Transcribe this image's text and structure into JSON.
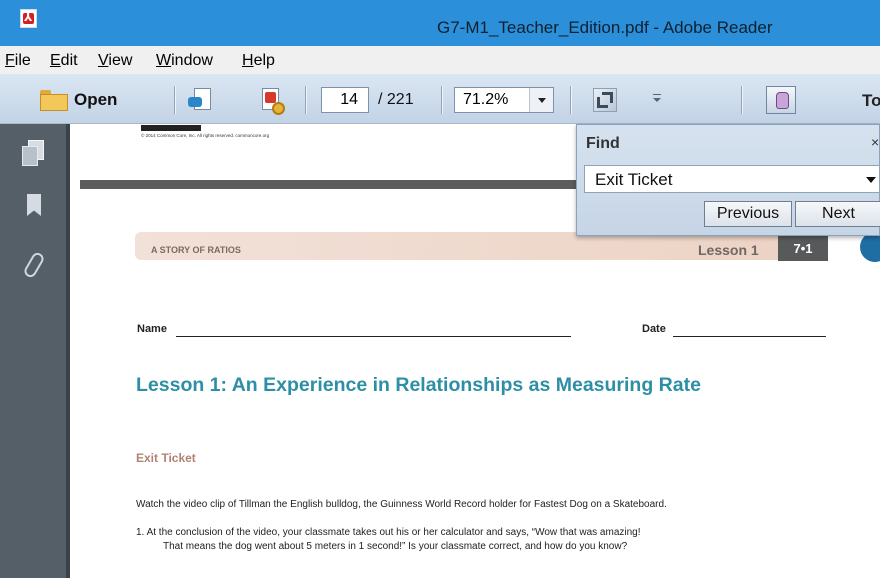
{
  "window": {
    "title": "G7-M1_Teacher_Edition.pdf - Adobe Reader"
  },
  "menu": {
    "items": [
      {
        "label": "File",
        "accel": "F",
        "rest": "ile"
      },
      {
        "label": "Edit",
        "accel": "E",
        "rest": "dit"
      },
      {
        "label": "View",
        "accel": "V",
        "rest": "iew"
      },
      {
        "label": "Window",
        "accel": "W",
        "rest": "indow"
      },
      {
        "label": "Help",
        "accel": "H",
        "rest": "elp"
      }
    ]
  },
  "toolbar": {
    "open_label": "Open",
    "page_number": "14",
    "page_total": "/ 221",
    "zoom": "71.2%",
    "tools_label": "To"
  },
  "find": {
    "title": "Find",
    "close": "×",
    "query": "Exit Ticket",
    "previous_label": "Previous",
    "next_label": "Next"
  },
  "document": {
    "copyright": "© 2014 Common Core, Inc. All rights reserved. commoncore.org",
    "banner_left": "A STORY OF RATIOS",
    "lesson_label": "Lesson 1",
    "grade_badge": "7•1",
    "name_label": "Name",
    "date_label": "Date",
    "lesson_title": "Lesson 1:  An Experience in Relationships as Measuring Rate",
    "exit_heading": "Exit Ticket",
    "instruction": "Watch the video clip of Tillman the English bulldog, the Guinness World Record holder for Fastest Dog on a Skateboard.",
    "q1_line1": "1.   At the conclusion of the video, your classmate takes out his or her calculator and says, “Wow that was amazing!",
    "q1_line2": "That means the dog went about 5 meters in 1 second!”  Is your classmate correct, and how do you know?"
  }
}
